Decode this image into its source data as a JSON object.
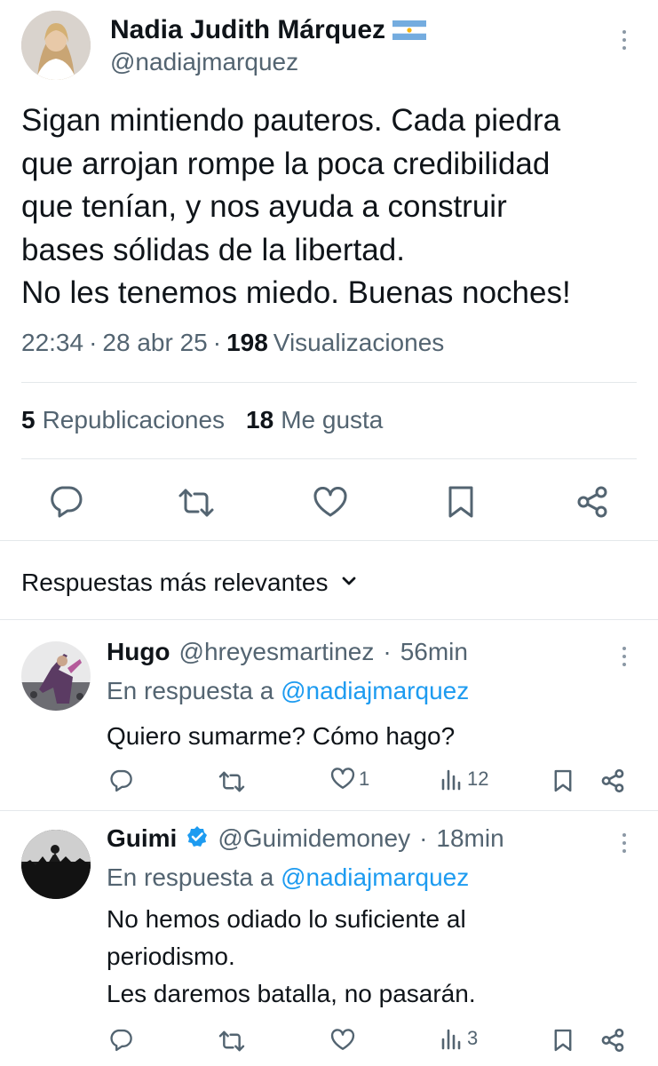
{
  "main_tweet": {
    "author_name": "Nadia Judith Márquez",
    "flag": "🇦🇷",
    "handle": "@nadiajmarquez",
    "text": "Sigan mintiendo pauteros. Cada piedra\nque arrojan rompe la poca credibilidad\nque tenían, y nos ayuda a construir\nbases sólidas de la libertad.\nNo les tenemos miedo. Buenas noches!",
    "time": "22:34",
    "date": "28 abr 25",
    "views_count": "198",
    "views_label": "Visualizaciones",
    "reposts_count": "5",
    "reposts_label": "Republicaciones",
    "likes_count": "18",
    "likes_label": "Me gusta"
  },
  "replies_header": "Respuestas más relevantes",
  "replies": [
    {
      "name": "Hugo",
      "handle": "@hreyesmartinez",
      "time": "56min",
      "in_reply_prefix": "En respuesta a",
      "in_reply_handle": "@nadiajmarquez",
      "text": "Quiero sumarme? Cómo hago?",
      "likes": "1",
      "views": "12"
    },
    {
      "name": "Guimi",
      "handle": "@Guimidemoney",
      "time": "18min",
      "in_reply_prefix": "En respuesta a",
      "in_reply_handle": "@nadiajmarquez",
      "text": "No hemos odiado lo suficiente al\nperiodismo.\nLes daremos batalla, no pasarán.",
      "likes": "",
      "views": "3"
    }
  ],
  "colors": {
    "accent": "#1d9bf0",
    "text": "#0f1419",
    "muted": "#536471",
    "icon": "#536471",
    "divider": "#e4e8eb"
  }
}
